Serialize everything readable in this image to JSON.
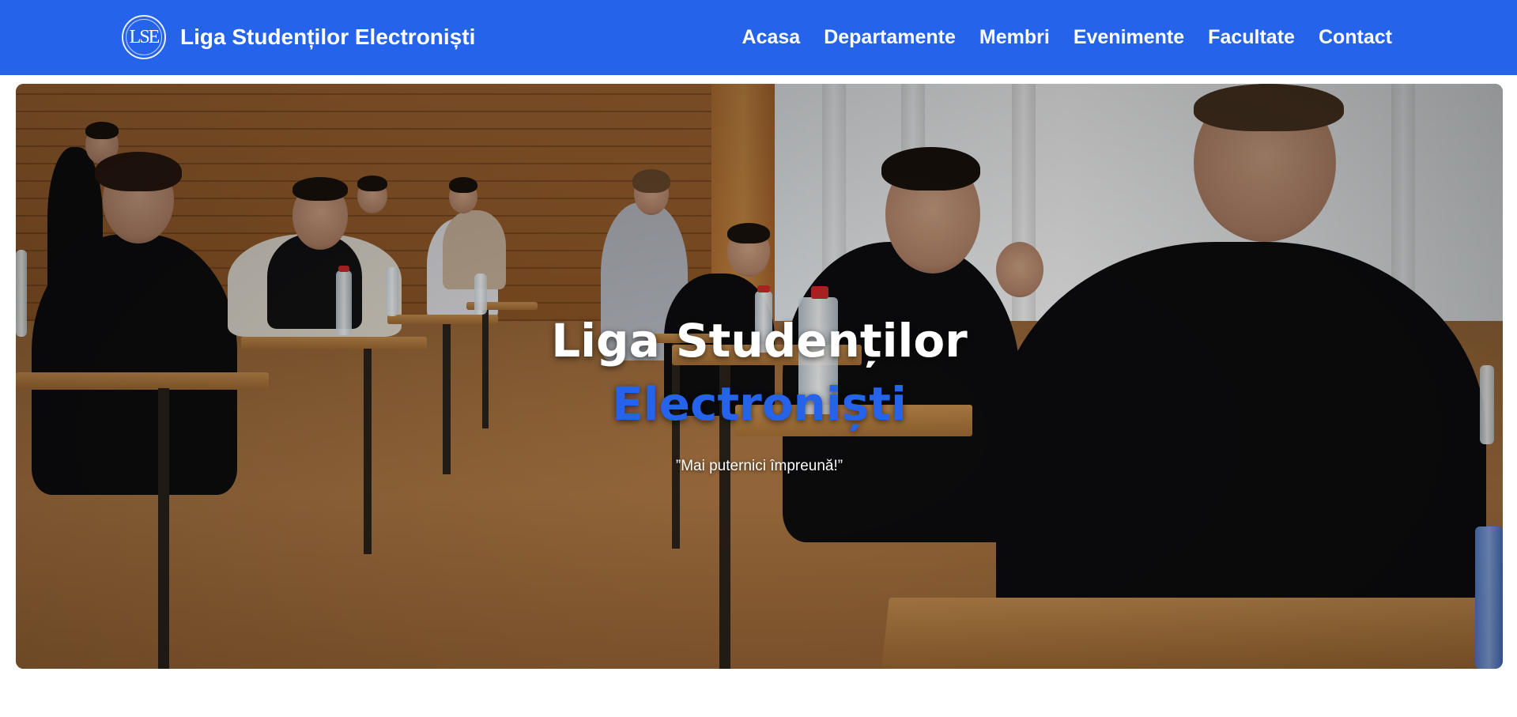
{
  "header": {
    "logo_text": "LSE",
    "brand_name": "Liga Studenților Electroniști",
    "nav": [
      "Acasa",
      "Departamente",
      "Membri",
      "Evenimente",
      "Facultate",
      "Contact"
    ],
    "background_color": "#2563eb"
  },
  "hero": {
    "title_line1": "Liga Studenților",
    "title_line2": "Electroniști",
    "tagline": "”Mai puternici împreună!”",
    "accent_color": "#2563eb",
    "image": "classroom-exam-photo"
  }
}
